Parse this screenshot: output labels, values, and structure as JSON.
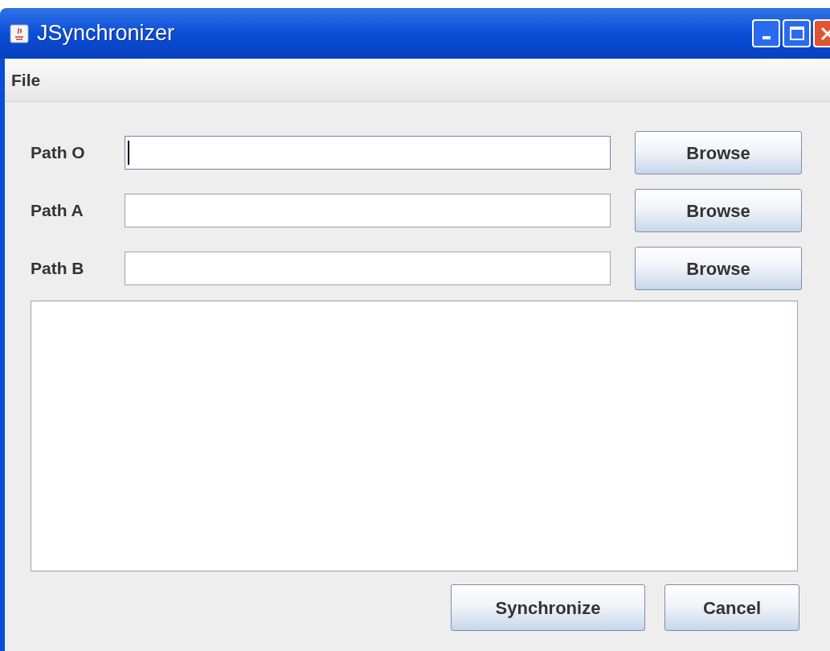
{
  "window": {
    "title": "JSynchronizer"
  },
  "menu": [
    "File"
  ],
  "paths": [
    {
      "label": "Path O",
      "focused": true,
      "button": "Browse"
    },
    {
      "label": "Path A",
      "focused": false,
      "button": "Browse"
    },
    {
      "label": "Path B",
      "focused": false,
      "button": "Browse"
    }
  ],
  "buttons": [
    "Synchronize",
    "Cancel"
  ]
}
